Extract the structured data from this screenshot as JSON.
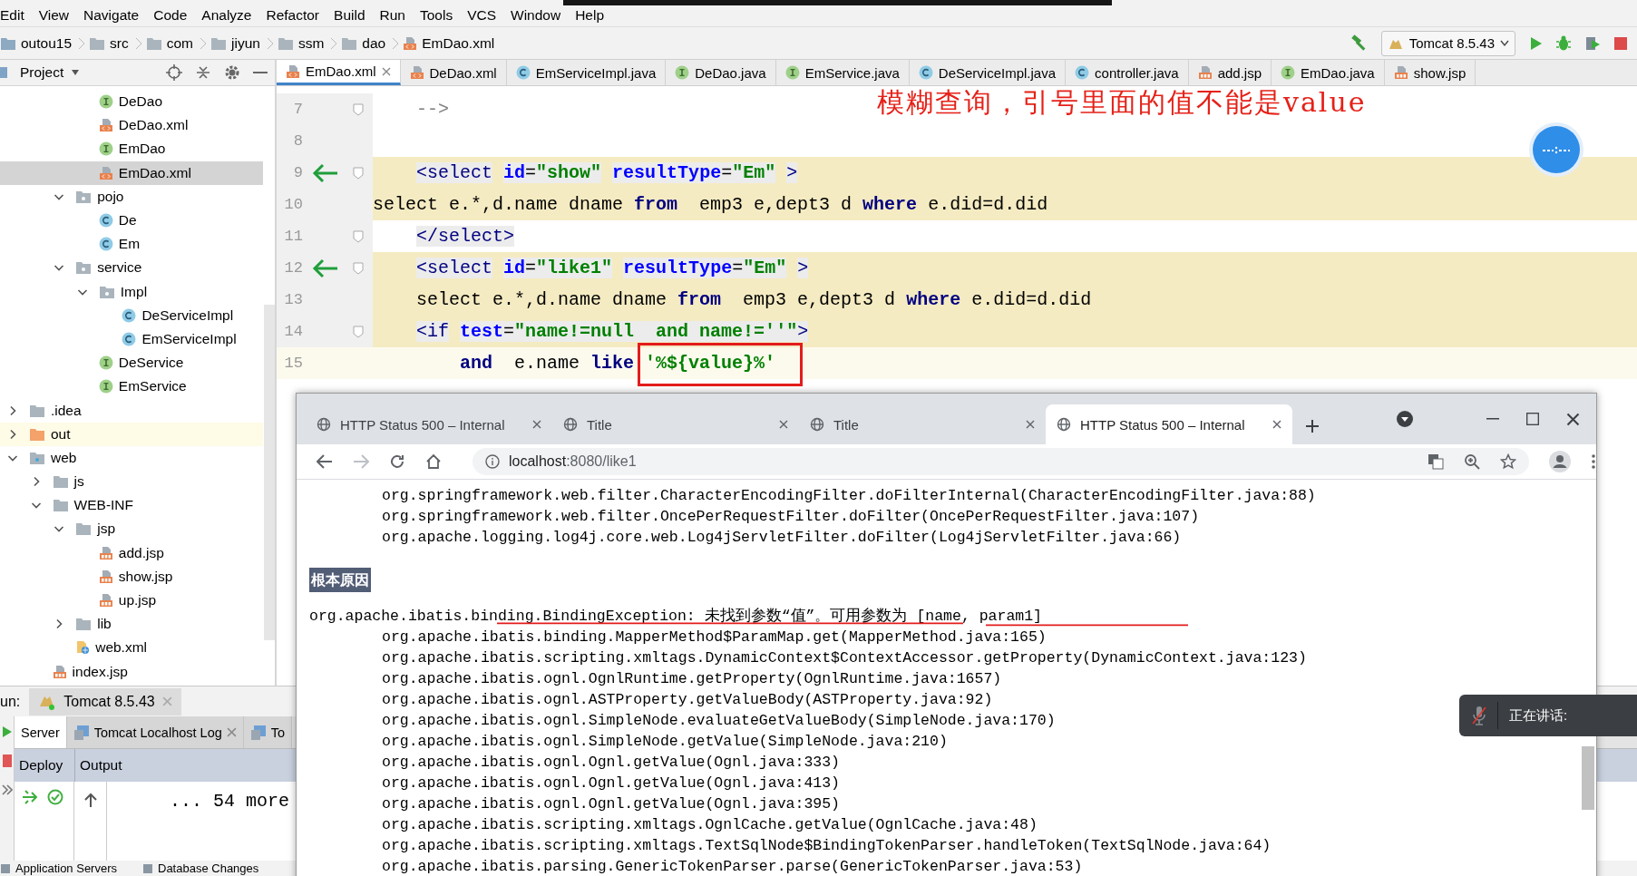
{
  "menu": [
    "Edit",
    "View",
    "Navigate",
    "Code",
    "Analyze",
    "Refactor",
    "Build",
    "Run",
    "Tools",
    "VCS",
    "Window",
    "Help"
  ],
  "breadcrumbs": [
    {
      "label": "outou15",
      "kind": "module"
    },
    {
      "label": "src",
      "kind": "folder"
    },
    {
      "label": "com",
      "kind": "folder"
    },
    {
      "label": "jiyun",
      "kind": "folder"
    },
    {
      "label": "ssm",
      "kind": "folder"
    },
    {
      "label": "dao",
      "kind": "folder"
    },
    {
      "label": "EmDao.xml",
      "kind": "xml"
    }
  ],
  "run_config": {
    "label": "Tomcat 8.5.43"
  },
  "project_panel": {
    "title": "Project",
    "tree": [
      {
        "children": [
          {
            "children": [
              {
                "children": [
                  {
                    "label": "DeDao",
                    "kind": "interface",
                    "selected": false
                  },
                  {
                    "label": "DeDao.xml",
                    "kind": "xml",
                    "selected": false
                  },
                  {
                    "label": "EmDao",
                    "kind": "interface",
                    "selected": false
                  },
                  {
                    "label": "EmDao.xml",
                    "kind": "xml",
                    "selected": true
                  }
                ]
              },
              {
                "label": "pojo",
                "kind": "package",
                "expanded": true,
                "selected": false,
                "children": [
                  {
                    "label": "De",
                    "kind": "class",
                    "selected": false
                  },
                  {
                    "label": "Em",
                    "kind": "class",
                    "selected": false
                  }
                ]
              },
              {
                "label": "service",
                "kind": "package",
                "expanded": true,
                "selected": false,
                "children": [
                  {
                    "label": "Impl",
                    "kind": "package",
                    "expanded": true,
                    "selected": false,
                    "children": [
                      {
                        "label": "DeServiceImpl",
                        "kind": "class",
                        "selected": false
                      },
                      {
                        "label": "EmServiceImpl",
                        "kind": "class",
                        "selected": false
                      }
                    ]
                  },
                  {
                    "label": "DeService",
                    "kind": "interface",
                    "selected": false
                  },
                  {
                    "label": "EmService",
                    "kind": "interface",
                    "selected": false
                  }
                ]
              }
            ]
          }
        ]
      },
      {
        "label": ".idea",
        "kind": "folder",
        "expanded": false,
        "selected": false
      },
      {
        "label": "out",
        "kind": "folder-excluded",
        "expanded": false,
        "selected": false
      },
      {
        "label": "web",
        "kind": "folder-web",
        "expanded": true,
        "selected": false,
        "children": [
          {
            "label": "js",
            "kind": "folder",
            "expanded": false,
            "selected": false
          },
          {
            "label": "WEB-INF",
            "kind": "folder",
            "expanded": true,
            "selected": false,
            "children": [
              {
                "label": "jsp",
                "kind": "folder",
                "expanded": true,
                "selected": false,
                "children": [
                  {
                    "label": "add.jsp",
                    "kind": "jsp",
                    "selected": false
                  },
                  {
                    "label": "show.jsp",
                    "kind": "jsp",
                    "selected": false
                  },
                  {
                    "label": "up.jsp",
                    "kind": "jsp",
                    "selected": false
                  }
                ]
              },
              {
                "label": "lib",
                "kind": "folder",
                "expanded": false,
                "selected": false
              },
              {
                "label": "web.xml",
                "kind": "webxml",
                "selected": false
              }
            ]
          },
          {
            "label": "index.jsp",
            "kind": "jsp",
            "selected": false
          }
        ]
      }
    ]
  },
  "editor": {
    "tabs": [
      {
        "label": "EmDao.xml",
        "kind": "xml",
        "selected": true
      },
      {
        "label": "DeDao.xml",
        "kind": "xml",
        "selected": false
      },
      {
        "label": "EmServiceImpl.java",
        "kind": "class",
        "selected": false
      },
      {
        "label": "DeDao.java",
        "kind": "interface",
        "selected": false
      },
      {
        "label": "EmService.java",
        "kind": "interface",
        "selected": false
      },
      {
        "label": "DeServiceImpl.java",
        "kind": "class",
        "selected": false
      },
      {
        "label": "controller.java",
        "kind": "class",
        "selected": false
      },
      {
        "label": "add.jsp",
        "kind": "jsp",
        "selected": false
      },
      {
        "label": "EmDao.java",
        "kind": "interface",
        "selected": false
      },
      {
        "label": "show.jsp",
        "kind": "jsp",
        "selected": false
      }
    ],
    "lines": [
      {
        "number": "7",
        "arrow": false,
        "fold": true,
        "injected": false,
        "caret_line": false,
        "segments": [
          {
            "text": "    -->",
            "kind": "comment"
          }
        ]
      },
      {
        "number": "8",
        "arrow": false,
        "fold": false
      },
      {
        "number": "9",
        "arrow": true,
        "fold": true,
        "injected": true,
        "caret_line": false,
        "segments": [
          {
            "text": "    <select",
            "kind": "tag"
          },
          {
            "text": " id",
            "kind": "attr"
          },
          {
            "text": "=",
            "kind": "punct"
          },
          {
            "text": "\"show\"",
            "kind": "value"
          },
          {
            "text": " resultType",
            "kind": "attr"
          },
          {
            "text": "=",
            "kind": "punct"
          },
          {
            "text": "\"Em\"",
            "kind": "value"
          },
          {
            "text": " >",
            "kind": "tag"
          }
        ]
      },
      {
        "number": "10",
        "arrow": false,
        "fold": false,
        "injected": true,
        "caret_line": false,
        "segments": [
          {
            "text": "select e.*,d.name dname ",
            "kind": "text"
          },
          {
            "text": "from",
            "kind": "keyword"
          },
          {
            "text": "  emp3 e,dept3 d ",
            "kind": "text"
          },
          {
            "text": "where",
            "kind": "keyword"
          },
          {
            "text": " e.did=d.did",
            "kind": "text"
          }
        ]
      },
      {
        "number": "11",
        "arrow": false,
        "fold": true,
        "injected": false,
        "caret_line": false,
        "segments": [
          {
            "text": "    </select>",
            "kind": "tag"
          }
        ]
      },
      {
        "number": "12",
        "arrow": true,
        "fold": true,
        "injected": true,
        "caret_line": false,
        "segments": [
          {
            "text": "    <select",
            "kind": "tag"
          },
          {
            "text": " id",
            "kind": "attr"
          },
          {
            "text": "=",
            "kind": "punct"
          },
          {
            "text": "\"like1\"",
            "kind": "value"
          },
          {
            "text": " resultType",
            "kind": "attr"
          },
          {
            "text": "=",
            "kind": "punct"
          },
          {
            "text": "\"Em\"",
            "kind": "value"
          },
          {
            "text": " >",
            "kind": "tag"
          }
        ]
      },
      {
        "number": "13",
        "arrow": false,
        "fold": false,
        "injected": true,
        "caret_line": false,
        "segments": [
          {
            "text": "    select e.*,d.name dname ",
            "kind": "text"
          },
          {
            "text": "from",
            "kind": "keyword"
          },
          {
            "text": "  emp3 e,dept3 d ",
            "kind": "text"
          },
          {
            "text": "where",
            "kind": "keyword"
          },
          {
            "text": " e.did=d.did",
            "kind": "text"
          }
        ]
      },
      {
        "number": "14",
        "arrow": false,
        "fold": true,
        "injected": true,
        "caret_line": false,
        "segments": [
          {
            "text": "    <if",
            "kind": "tag"
          },
          {
            "text": " test",
            "kind": "attr"
          },
          {
            "text": "=",
            "kind": "punct"
          },
          {
            "text": "\"name!=null  and name!=''\"",
            "kind": "value"
          },
          {
            "text": ">",
            "kind": "tag"
          }
        ]
      },
      {
        "number": "15",
        "arrow": false,
        "fold": false,
        "injected": false,
        "caret_line": true,
        "segments": [
          {
            "text": "        and",
            "kind": "keyword"
          },
          {
            "text": "  e.name ",
            "kind": "text"
          },
          {
            "text": "like",
            "kind": "keyword"
          },
          {
            "text": " '%${value}%'",
            "kind": "value"
          }
        ]
      }
    ],
    "note": "模糊查询，引号里面的值不能是value"
  },
  "browser": {
    "tabs": [
      {
        "title": "HTTP Status 500 – Internal",
        "selected": false
      },
      {
        "title": "Title",
        "selected": false
      },
      {
        "title": "Title",
        "selected": false
      },
      {
        "title": "HTTP Status 500 – Internal",
        "selected": true
      }
    ],
    "url": {
      "host": "localhost",
      "path": ":8080/like1"
    },
    "content": [
      {
        "kind": "frame",
        "text": "org.springframework.web.filter.CharacterEncodingFilter.doFilterInternal(CharacterEncodingFilter.java:88)"
      },
      {
        "kind": "frame",
        "text": "org.springframework.web.filter.OncePerRequestFilter.doFilter(OncePerRequestFilter.java:107)"
      },
      {
        "kind": "frame",
        "text": "org.apache.logging.log4j.core.web.Log4jServletFilter.doFilter(Log4jServletFilter.java:66)"
      },
      {
        "kind": "heading",
        "text": "根本原因"
      },
      {
        "kind": "exception",
        "text": "org.apache.ibatis.binding.BindingException: 未找到参数“值”。可用参数为 [name, param1]"
      },
      {
        "kind": "frame",
        "text": "org.apache.ibatis.binding.MapperMethod$ParamMap.get(MapperMethod.java:165)"
      },
      {
        "kind": "frame",
        "text": "org.apache.ibatis.scripting.xmltags.DynamicContext$ContextAccessor.getProperty(DynamicContext.java:123)"
      },
      {
        "kind": "frame",
        "text": "org.apache.ibatis.ognl.OgnlRuntime.getProperty(OgnlRuntime.java:1657)"
      },
      {
        "kind": "frame",
        "text": "org.apache.ibatis.ognl.ASTProperty.getValueBody(ASTProperty.java:92)"
      },
      {
        "kind": "frame",
        "text": "org.apache.ibatis.ognl.SimpleNode.evaluateGetValueBody(SimpleNode.java:170)"
      },
      {
        "kind": "frame",
        "text": "org.apache.ibatis.ognl.SimpleNode.getValue(SimpleNode.java:210)"
      },
      {
        "kind": "frame",
        "text": "org.apache.ibatis.ognl.Ognl.getValue(Ognl.java:333)"
      },
      {
        "kind": "frame",
        "text": "org.apache.ibatis.ognl.Ognl.getValue(Ognl.java:413)"
      },
      {
        "kind": "frame",
        "text": "org.apache.ibatis.ognl.Ognl.getValue(Ognl.java:395)"
      },
      {
        "kind": "frame",
        "text": "org.apache.ibatis.scripting.xmltags.OgnlCache.getValue(OgnlCache.java:48)"
      },
      {
        "kind": "frame",
        "text": "org.apache.ibatis.scripting.xmltags.TextSqlNode$BindingTokenParser.handleToken(TextSqlNode.java:64)"
      },
      {
        "kind": "frame",
        "text": "org.apache.ibatis.parsing.GenericTokenParser.parse(GenericTokenParser.java:53)"
      }
    ]
  },
  "run_panel": {
    "label": "un:",
    "config_tab": "Tomcat 8.5.43",
    "tabs": [
      {
        "label": "Server",
        "selected": true,
        "closable": false
      },
      {
        "label": "Tomcat Localhost Log",
        "selected": false,
        "closable": true
      },
      {
        "label": "To",
        "selected": false,
        "closable": false
      }
    ],
    "columns": [
      "Deploy",
      "Output"
    ],
    "output": "... 54 more"
  },
  "status_bar": {
    "items": [
      "Application Servers",
      "Database Changes"
    ]
  },
  "toast": {
    "text": "正在讲话:"
  }
}
